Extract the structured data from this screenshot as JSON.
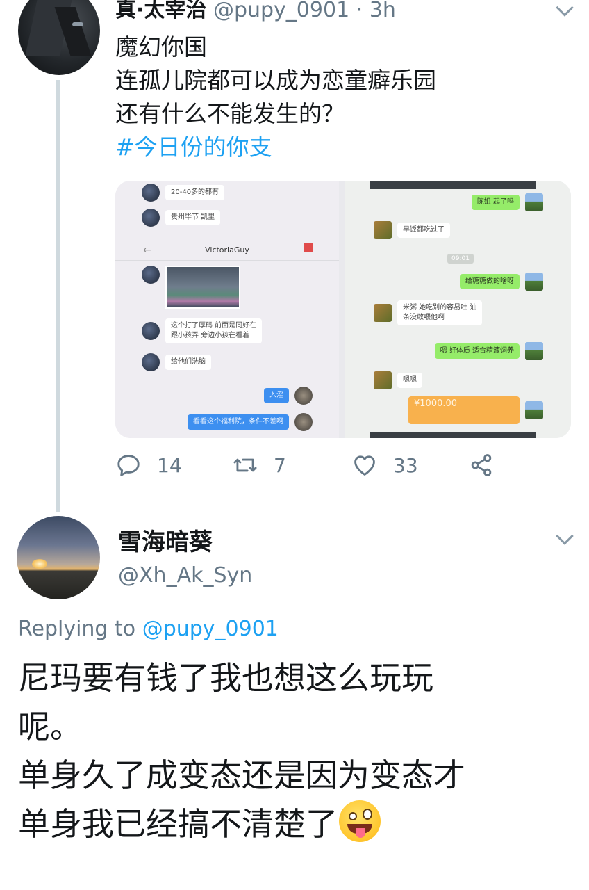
{
  "tweet": {
    "display_name": "真·太宰治",
    "meta": "@pupy_0901 · 3h",
    "text_lines": [
      "魔幻你国",
      "连孤儿院都可以成为恋童癖乐园",
      "还有什么不能发生的？"
    ],
    "hashtag": "#今日份的你支",
    "media": {
      "left": {
        "title": "VictoriaGuy",
        "messages": [
          "20-40多的都有",
          "贵州毕节 凯里",
          "这个打了厚码 前面是同好在",
          "跟小孩弄 旁边小孩在看着",
          "给他们洗脑",
          "入淫",
          "看看这个福利院，条件不差啊"
        ]
      },
      "right": {
        "time_chip": "09:01",
        "messages": [
          "陈姐 起了吗",
          "早饭都吃过了",
          "给糖糖做的啥呀",
          "米粥 她吃别的容易吐 油",
          "条没敢喂他啊",
          "嗯 好体质 适合精液饲养",
          "嗯嗯",
          "¥1000.00"
        ]
      }
    },
    "actions": {
      "reply_count": "14",
      "retweet_count": "7",
      "like_count": "33"
    },
    "colors": {
      "link": "#1da1f2",
      "muted": "#657786",
      "thread_line": "#cfd9de"
    }
  },
  "reply": {
    "display_name": "雪海暗葵",
    "handle": "@Xh_Ak_Syn",
    "replying_prefix": "Replying to",
    "replying_mention": "@pupy_0901",
    "body_lines": [
      "尼玛要有钱了我也想这么玩玩",
      "呢。",
      "单身久了成变态还是因为变态才",
      "单身我已经搞不清楚了"
    ],
    "emoji": "zany-face-icon"
  }
}
